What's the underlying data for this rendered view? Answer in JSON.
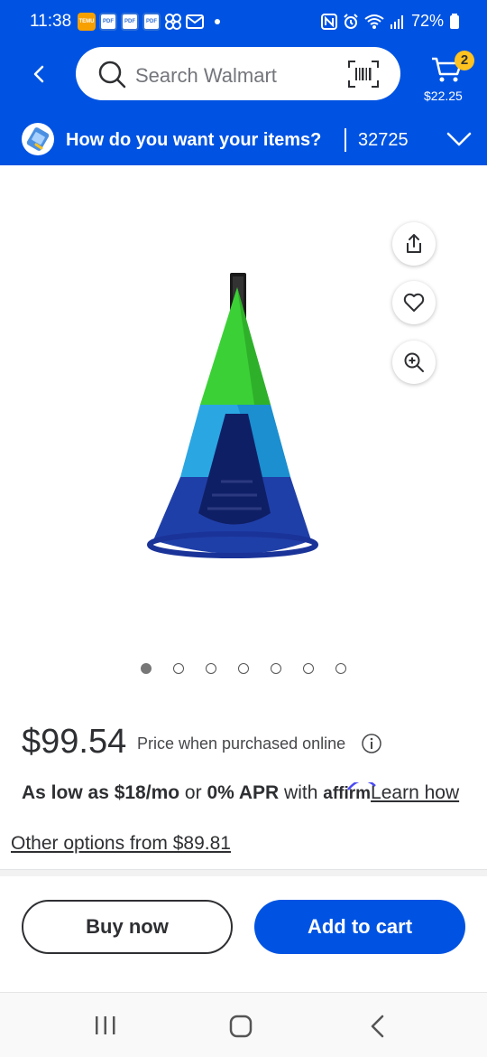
{
  "status_bar": {
    "time": "11:38",
    "battery": "72%",
    "left_icons": [
      "temu-icon",
      "pdf-icon",
      "pdf-icon",
      "pdf-icon",
      "pinwheel-icon",
      "mail-icon"
    ],
    "right_icons": [
      "nfc-icon",
      "alarm-icon",
      "wifi-icon",
      "signal-icon",
      "battery-icon"
    ]
  },
  "header": {
    "search_placeholder": "Search Walmart",
    "cart_count": "2",
    "cart_total": "$22.25",
    "delivery_label": "How do you want your items?",
    "zip": "32725",
    "brand_color": "#0053e2"
  },
  "product": {
    "image_alt": "Hanging teepee swing tent in green, blue and navy",
    "carousel_count": 7,
    "carousel_active": 1,
    "price": "$99.54",
    "price_note": "Price when purchased online",
    "affirm": {
      "as_low_as": "As low as $18/mo",
      "or": "or",
      "apr": "0% APR",
      "with": "with",
      "logo": "affirm",
      "learn": "Learn how"
    },
    "other_options": "Other options from $89.81"
  },
  "actions": {
    "buy_now": "Buy now",
    "add_to_cart": "Add to cart"
  },
  "colors": {
    "accent_blue": "#0053e2",
    "cart_badge": "#ffc220"
  }
}
